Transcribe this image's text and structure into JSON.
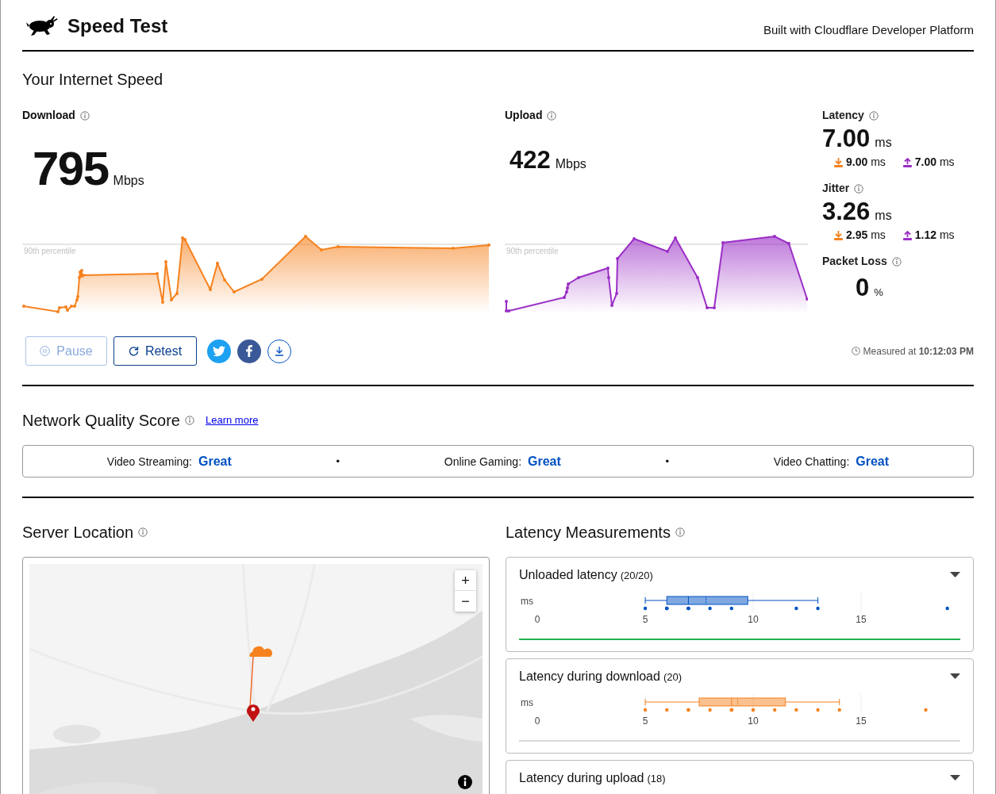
{
  "header": {
    "title": "Speed Test",
    "credit": "Built with Cloudflare Developer Platform"
  },
  "speed": {
    "heading": "Your Internet Speed",
    "download": {
      "label": "Download",
      "value": "795",
      "unit": "Mbps",
      "percentile_label": "90th percentile"
    },
    "upload": {
      "label": "Upload",
      "value": "422",
      "unit": "Mbps",
      "percentile_label": "90th percentile"
    },
    "metrics": [
      {
        "label": "Latency",
        "value": "7.00",
        "unit": "ms",
        "down": "9.00 ms",
        "up": "7.00 ms"
      },
      {
        "label": "Jitter",
        "value": "3.26",
        "unit": "ms",
        "down": "2.95 ms",
        "up": "1.12 ms"
      },
      {
        "label": "Packet Loss",
        "value": "0",
        "unit": "%"
      }
    ],
    "buttons": [
      {
        "kind": "pause",
        "label": "Pause",
        "disabled": true
      },
      {
        "kind": "retest",
        "label": "Retest",
        "disabled": false
      }
    ],
    "share": [
      {
        "kind": "twitter"
      },
      {
        "kind": "facebook"
      },
      {
        "kind": "download"
      }
    ],
    "measured": "Measured at **10:12:03 PM**"
  },
  "quality": {
    "heading": "Network Quality Score",
    "link": "Learn more",
    "scores": [
      {
        "label": "Video Streaming:",
        "value": "Great",
        "separator": "•"
      },
      {
        "label": "Online Gaming:",
        "value": "Great",
        "separator": "•"
      },
      {
        "label": "Video Chatting:",
        "value": "Great"
      }
    ]
  },
  "server": {
    "heading": "Server Location",
    "map": {
      "kind": "picture",
      "zoom_in": "+",
      "zoom_out": "−"
    }
  },
  "latency": {
    "heading": "Latency Measurements",
    "cards": [
      {
        "title": "Unloaded latency",
        "count": "(20/20)",
        "kind": "unloaded",
        "color": "#22b14c",
        "axis": {
          "unit": "ms",
          "ticks": [
            "0",
            "5",
            "10",
            "15"
          ]
        }
      },
      {
        "title": "Latency during download",
        "count": "(20)",
        "kind": "download",
        "color": "#d9d9d9",
        "axis": {
          "unit": "ms",
          "ticks": [
            "0",
            "5",
            "10",
            "15"
          ]
        }
      },
      {
        "title": "Latency during upload",
        "count": "(18)"
      }
    ]
  }
}
